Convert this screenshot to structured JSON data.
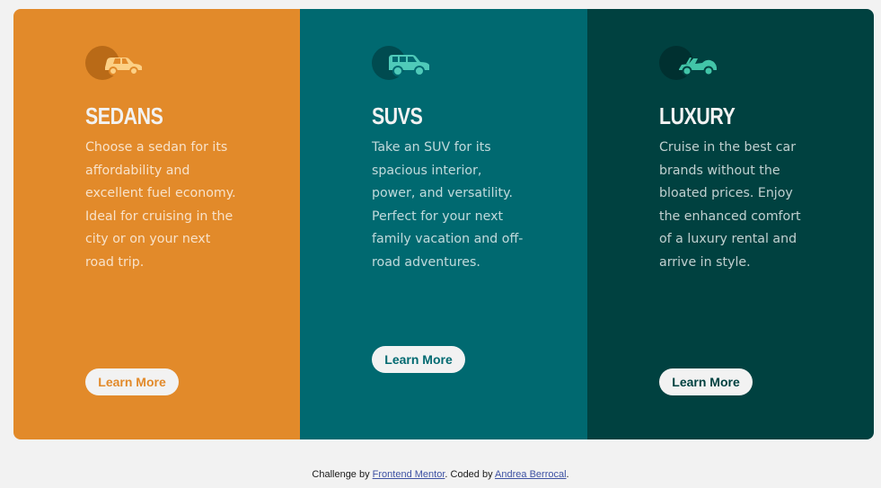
{
  "cards": [
    {
      "title": "SEDANS",
      "description": "Choose a sedan for its affordability and excellent fuel economy. Ideal for cruising in the city or on your next road trip.",
      "button_label": "Learn More",
      "icon": "sedan-icon",
      "color": "#e28a2a"
    },
    {
      "title": "SUVS",
      "description": "Take an SUV for its spacious interior, power, and versatility. Perfect for your next family vacation and off-road adventures.",
      "button_label": "Learn More",
      "icon": "suv-icon",
      "color": "#006970"
    },
    {
      "title": "LUXURY",
      "description": "Cruise in the best car brands without the bloated prices. Enjoy the enhanced comfort of a luxury rental and arrive in style.",
      "button_label": "Learn More",
      "icon": "luxury-car-icon",
      "color": "#004140"
    }
  ],
  "attribution": {
    "prefix": "Challenge by ",
    "link1": "Frontend Mentor",
    "middle": ". Coded by ",
    "link2": "Andrea Berrocal",
    "suffix": "."
  },
  "colors": {
    "background": "#f2f2f2",
    "link": "#3e52a3"
  }
}
